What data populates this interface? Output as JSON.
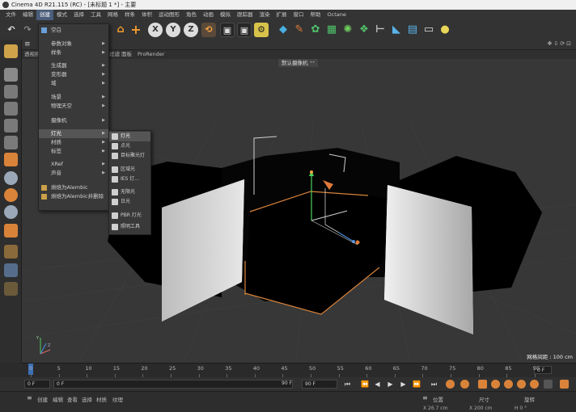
{
  "window": {
    "title": "Cinema 4D R21.115 (RC) - [未标题 1 *] - 主要"
  },
  "menubar": {
    "items": [
      "文件",
      "编辑",
      "创建",
      "模式",
      "选择",
      "工具",
      "网格",
      "样条",
      "体积",
      "运动图形",
      "角色",
      "动画",
      "模拟",
      "跟踪器",
      "渲染",
      "扩展",
      "窗口",
      "帮助",
      "Octane"
    ],
    "active_index": 2
  },
  "viewport": {
    "tabs": [
      "透视视图"
    ],
    "header_menus": [
      "过滤",
      "面板",
      "ProRender"
    ],
    "camera_label": "默认摄像机 ⁺⁺",
    "grid_distance": "网格间距 : 100 cm"
  },
  "create_menu": {
    "items": [
      {
        "label": "空白",
        "icon": "null-object-icon",
        "submenu": false
      },
      {
        "label": "参数对象",
        "submenu": true
      },
      {
        "label": "样条",
        "submenu": true
      },
      {
        "label": "生成器",
        "submenu": true
      },
      {
        "label": "变形器",
        "submenu": true
      },
      {
        "label": "域",
        "submenu": true
      },
      {
        "label": "场景",
        "submenu": true
      },
      {
        "label": "物理天空",
        "submenu": true
      },
      {
        "label": "摄像机",
        "submenu": true
      },
      {
        "label": "灯光",
        "submenu": true,
        "highlighted": true
      },
      {
        "label": "材质",
        "submenu": true
      },
      {
        "label": "标签",
        "submenu": true
      },
      {
        "label": "XRef",
        "submenu": true
      },
      {
        "label": "声音",
        "submenu": true
      },
      {
        "label": "烘焙为Alembic",
        "icon": "alembic-icon",
        "submenu": false
      },
      {
        "label": "烘焙为Alembic并删除",
        "icon": "alembic-icon",
        "submenu": false
      }
    ]
  },
  "light_submenu": {
    "items": [
      {
        "label": "灯光",
        "icon": "light-bulb-icon",
        "highlighted": true
      },
      {
        "label": "点光",
        "icon": "spot-light-icon"
      },
      {
        "label": "目标聚光灯",
        "icon": "target-spot-light-icon"
      },
      {
        "label": "区域光",
        "icon": "area-light-icon"
      },
      {
        "label": "IES 灯...",
        "icon": "ies-light-icon"
      },
      {
        "label": "无限光",
        "icon": "infinite-light-icon"
      },
      {
        "label": "日光",
        "icon": "sun-light-icon"
      },
      {
        "label": "PBR 灯光",
        "icon": "pbr-light-icon"
      },
      {
        "label": "照明工具",
        "icon": "lighting-tool-icon"
      }
    ]
  },
  "timeline": {
    "ticks": [
      "0",
      "5",
      "10",
      "15",
      "20",
      "25",
      "30",
      "35",
      "40",
      "45",
      "50",
      "55",
      "60",
      "65",
      "70",
      "75",
      "80",
      "85",
      "90"
    ],
    "current_frame": "0 F"
  },
  "transport": {
    "start_field": "0 F",
    "min_field": "0 F",
    "max_field": "90 F",
    "end_field": "90 F"
  },
  "bottom": {
    "left_tabs": [
      "创建",
      "编辑",
      "查看",
      "选择",
      "材质",
      "纹理"
    ],
    "right_headers": [
      "位置",
      "尺寸",
      "旋转"
    ],
    "coords": [
      "X 26.7 cm",
      "X 200 cm",
      "H 0 °"
    ]
  },
  "colors": {
    "accent_blue": "#3d6fb6",
    "menu_highlight": "#555555",
    "orange_edge": "#d9833a",
    "panel_white": "#d8d8d8"
  }
}
